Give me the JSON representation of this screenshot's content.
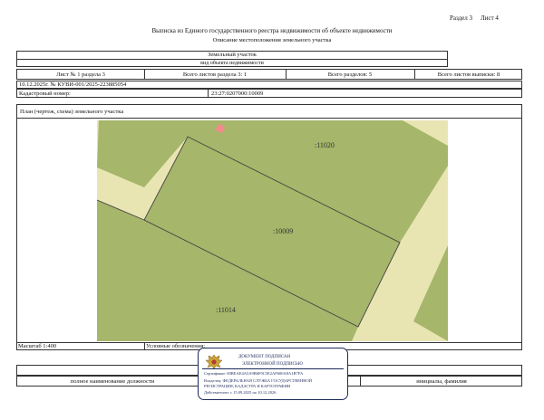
{
  "header": {
    "section_label": "Раздел 3",
    "sheet_label": "Лист 4",
    "title": "Выписка из Единого государственного реестра недвижимости об объекте недвижимости",
    "subtitle": "Описание местоположения земельного участка"
  },
  "object": {
    "type": "Земельный участок",
    "type_caption": "вид объекта недвижимости"
  },
  "sheet_row": {
    "sheet_in_section": "Лист № 1 раздела 3",
    "total_sheets_section": "Всего листов раздела 3: 1",
    "total_sections": "Всего разделов: 5",
    "total_sheets_extract": "Всего листов выписки: 8"
  },
  "reference": {
    "date_number": "10.12.2025г. № КУВИ-001/2025-223885054",
    "cadastral_label": "Кадастровый номер:",
    "cadastral_number": "23:27:0207000:10009"
  },
  "plan": {
    "title": "План (чертеж, схема) земельного участка",
    "labels": {
      "top_right": ":11020",
      "center": ":10009",
      "bottom_left": ":11014"
    },
    "colors": {
      "background": "#e9e5b3",
      "parcel": "#a6b66a",
      "marker": "#f08c8c",
      "border": "#444444"
    }
  },
  "footer": {
    "scale": "Масштаб 1:400",
    "legend_label": "Условные обозначения:",
    "position_caption": "полное наименование должности",
    "signature_caption": "инициалы, фамилия"
  },
  "stamp": {
    "line1": "ДОКУМЕНТ ПОДПИСАН",
    "line2": "ЭЛЕКТРОННОЙ ПОДПИСЬЮ",
    "cert": "Сертификат: 00BEAE4A5A9B6F0C5E2AF600A8A1B7FA",
    "owner_line1": "Владелец: ФЕДЕРАЛЬНАЯ СЛУЖБА ГОСУДАРСТВЕННОЙ",
    "owner_line2": "РЕГИСТРАЦИИ, КАДАСТРА И КАРТОГРАФИИ",
    "valid": "Действителен: с 15.09.2025 по 10.12.2026"
  }
}
